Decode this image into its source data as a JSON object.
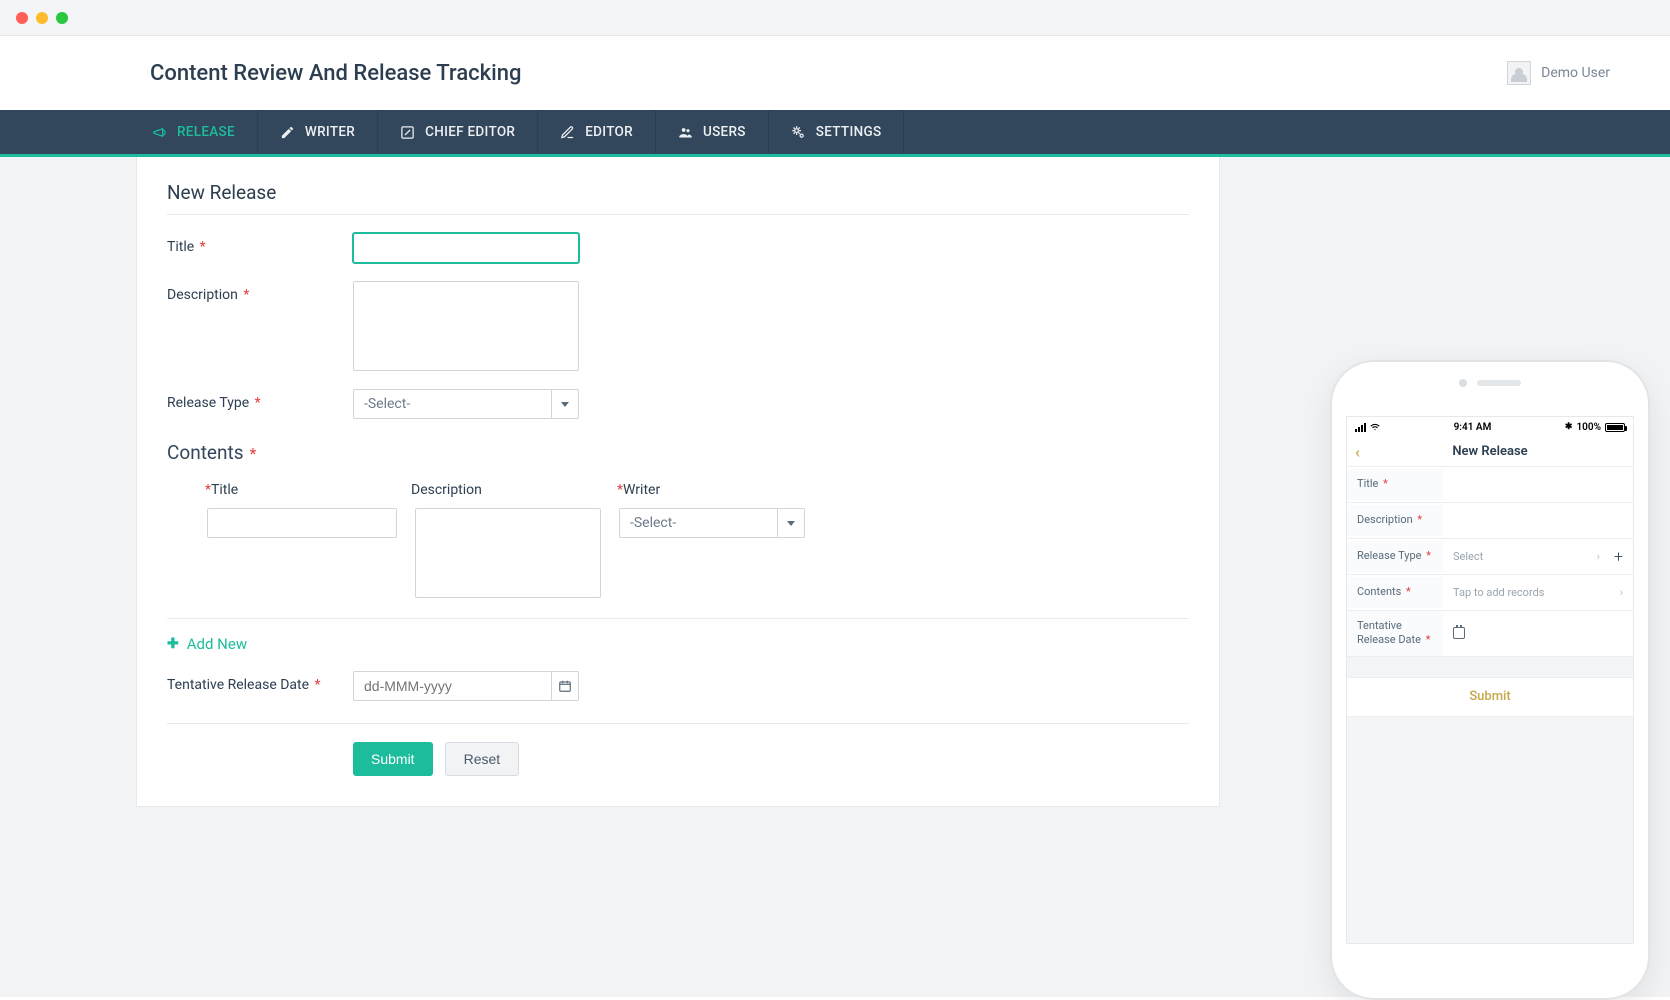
{
  "app_title": "Content Review And Release Tracking",
  "user": {
    "name": "Demo User"
  },
  "nav": {
    "items": [
      {
        "label": "RELEASE",
        "icon": "megaphone-icon",
        "active": true
      },
      {
        "label": "WRITER",
        "icon": "pencil-icon",
        "active": false
      },
      {
        "label": "CHIEF EDITOR",
        "icon": "edit-square-icon",
        "active": false
      },
      {
        "label": "EDITOR",
        "icon": "compose-icon",
        "active": false
      },
      {
        "label": "USERS",
        "icon": "users-icon",
        "active": false
      },
      {
        "label": "SETTINGS",
        "icon": "gears-icon",
        "active": false
      }
    ]
  },
  "form": {
    "section_title": "New Release",
    "labels": {
      "title": "Title",
      "description": "Description",
      "release_type": "Release Type",
      "contents": "Contents",
      "tentative_date": "Tentative Release Date"
    },
    "release_type_placeholder": "-Select-",
    "date_placeholder": "dd-MMM-yyyy",
    "contents_columns": {
      "title": "Title",
      "description": "Description",
      "writer": "Writer"
    },
    "contents_writer_placeholder": "-Select-",
    "add_new_label": "Add New",
    "buttons": {
      "submit": "Submit",
      "reset": "Reset"
    }
  },
  "mobile": {
    "status": {
      "time": "9:41 AM",
      "battery": "100%"
    },
    "header_title": "New Release",
    "rows": {
      "title": {
        "label": "Title"
      },
      "description": {
        "label": "Description"
      },
      "release_type": {
        "label": "Release Type",
        "placeholder": "Select"
      },
      "contents": {
        "label": "Contents",
        "placeholder": "Tap to add records"
      },
      "tentative_date": {
        "label": "Tentative Release Date"
      }
    },
    "submit_label": "Submit"
  }
}
